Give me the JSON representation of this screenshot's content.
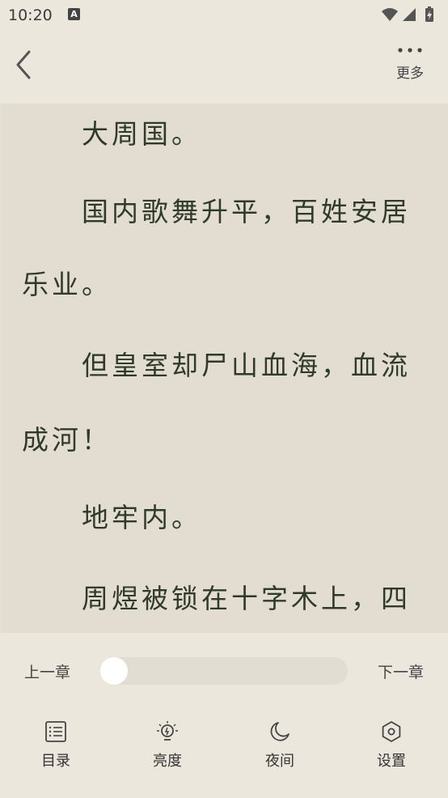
{
  "status_bar": {
    "time": "10:20",
    "a_label": "A",
    "icons": [
      "wifi-icon",
      "signal-icon",
      "battery-icon"
    ]
  },
  "top_bar": {
    "back_icon": "chevron-left-icon",
    "more_label": "更多",
    "more_icon": "more-dots-icon"
  },
  "reading": {
    "lines": [
      "　　大周国。",
      "　　国内歌舞升平，百姓安居",
      "乐业。",
      "　　但皇室却尸山血海，血流",
      "成河！",
      "　　地牢内。",
      "　　周煜被锁在十字木上，四"
    ]
  },
  "controls": {
    "prev_chapter": "上一章",
    "next_chapter": "下一章",
    "progress": 0.0
  },
  "toolbar": {
    "items": [
      {
        "label": "目录",
        "icon": "list-icon"
      },
      {
        "label": "亮度",
        "icon": "lightbulb-icon"
      },
      {
        "label": "夜间",
        "icon": "moon-icon"
      },
      {
        "label": "设置",
        "icon": "hexagon-settings-icon"
      }
    ]
  },
  "colors": {
    "background": "#ece7dd",
    "page": "#e3dcd0",
    "text": "#2f3a2b"
  }
}
